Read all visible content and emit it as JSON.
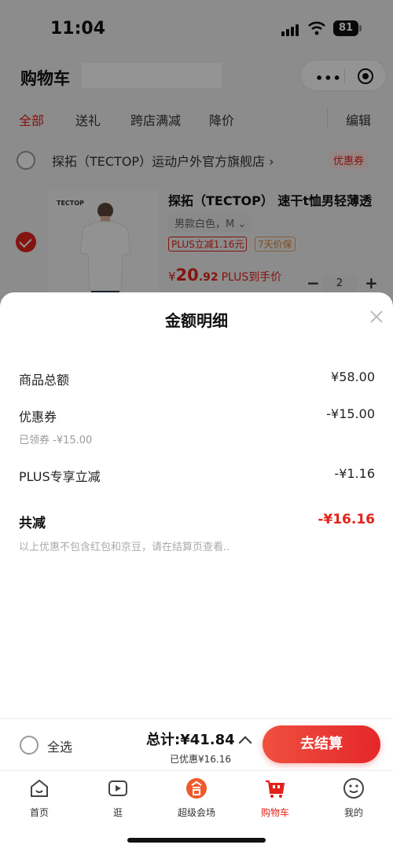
{
  "status_bar": {
    "time": "11:04",
    "battery": "81"
  },
  "nav": {
    "title": "购物车",
    "capsule_more": "•••"
  },
  "filter_tabs": [
    {
      "label": "全部",
      "active": true
    },
    {
      "label": "送礼",
      "active": false
    },
    {
      "label": "跨店满减",
      "active": false
    },
    {
      "label": "降价",
      "active": false
    }
  ],
  "edit_label": "编辑",
  "shop": {
    "name": "探拓（TECTOP）运动户外官方旗舰店 ›",
    "coupon_tag": "优惠券"
  },
  "item": {
    "brand_mark": "TECTOP",
    "title": "探拓（TECTOP） 速干t恤男轻薄透",
    "spec": "男款白色，M  ⌄",
    "tags": [
      "PLUS立减1.16元",
      "7天价保"
    ],
    "price_currency": "¥",
    "price_int": "20",
    "price_dec": ".92",
    "price_note": "PLUS到手价",
    "quantity": "2",
    "minus": "−",
    "plus": "+"
  },
  "sheet": {
    "title": "金额明细",
    "lines": [
      {
        "label": "商品总额",
        "value": "¥58.00"
      },
      {
        "label": "优惠券",
        "value": "-¥15.00",
        "sub": "已领券 -¥15.00"
      },
      {
        "label": "PLUS专享立减",
        "value": "-¥1.16"
      }
    ],
    "total_label": "共减",
    "total_value": "-¥16.16",
    "note": "以上优惠不包含红包和京豆，请在结算页查看.."
  },
  "checkout": {
    "select_all": "全选",
    "total": "总计:¥41.84",
    "saved": "已优惠¥16.16",
    "button": "去结算"
  },
  "tabbar": [
    {
      "label": "首页",
      "icon": "home-icon"
    },
    {
      "label": "逛",
      "icon": "video-icon"
    },
    {
      "label": "超级会场",
      "icon": "venue-icon"
    },
    {
      "label": "购物车",
      "icon": "cart-icon",
      "active": true
    },
    {
      "label": "我的",
      "icon": "profile-icon"
    }
  ],
  "colors": {
    "accent": "#e2231a",
    "orange": "#d9822b"
  }
}
